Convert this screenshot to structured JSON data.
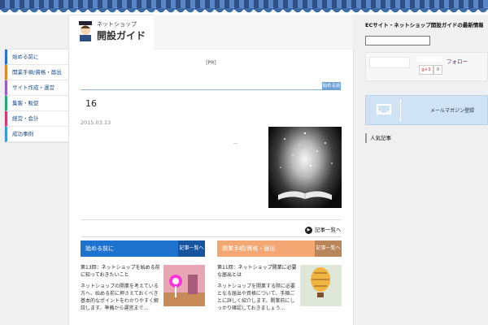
{
  "header": {
    "logo_small": "ネットショップ",
    "logo_big": "開設ガイド"
  },
  "nav": {
    "items": [
      {
        "label": "始める前に",
        "color": "#2a6fd6"
      },
      {
        "label": "開業手順/資格・届出",
        "color": "#e08a2c"
      },
      {
        "label": "サイト作成・運営",
        "color": "#9a5cc6"
      },
      {
        "label": "集客・販促",
        "color": "#2aa87a"
      },
      {
        "label": "経営・会計",
        "color": "#d43a6e"
      },
      {
        "label": "成功事例",
        "color": "#3a9ad4"
      }
    ]
  },
  "main": {
    "pr": "[PR]",
    "category_tag": "始める前に",
    "post_title": "16",
    "post_date": "2015.03.13",
    "post_excerpt": "...",
    "more_label": "記事一覧へ",
    "boxes": [
      {
        "name": "始める前に",
        "list_label": "記事一覧へ",
        "head_color": "#1e73cf",
        "list_color": "#17569e",
        "subtitle": "第13回：ネットショップを始める前に知っておきたいこと",
        "body": "ネットショップの開業を考えている方へ、始める前に押さえておくべき基本的なポイントをわかりやすく解説します。準備から運営まで…"
      },
      {
        "name": "開業手順/資格・届出",
        "list_label": "記事一覧へ",
        "head_color": "#f3a874",
        "list_color": "#b9855b",
        "subtitle": "第11回：ネットショップ開業に必要な届出とは",
        "body": "ネットショップを開業する際に必要となる届出や資格について、手順ごとに詳しく紹介します。開業前にしっかり確認しておきましょう…"
      }
    ]
  },
  "sidebar": {
    "heading": "ECサイト・ネットショップ開設ガイドの最新情報をお届け",
    "search_value": "",
    "follow_label": "フォロー",
    "gplus_label": "g+1",
    "gplus_count": "0",
    "mail_label": "メールマガジン登録",
    "section_title": "人気記事"
  }
}
